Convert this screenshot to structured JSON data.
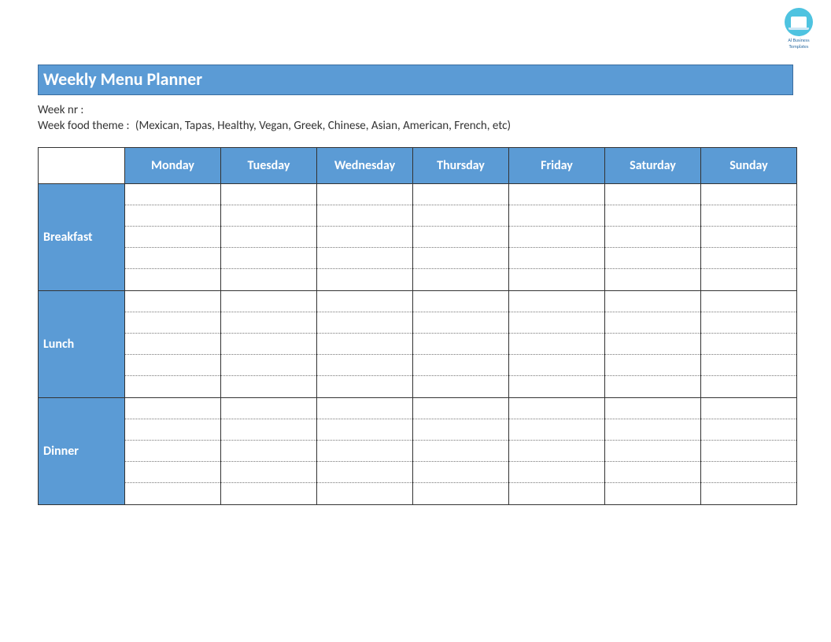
{
  "logo": {
    "line1": "Al Business",
    "line2": "Templates"
  },
  "title": "Weekly Menu Planner",
  "meta": {
    "week_nr_label": "Week nr :",
    "theme_label": "Week food theme :",
    "theme_hint": "(Mexican, Tapas, Healthy, Vegan, Greek, Chinese, Asian, American, French, etc)"
  },
  "days": [
    "Monday",
    "Tuesday",
    "Wednesday",
    "Thursday",
    "Friday",
    "Saturday",
    "Sunday"
  ],
  "meals": [
    {
      "name": "Breakfast",
      "rows": 5
    },
    {
      "name": "Lunch",
      "rows": 5
    },
    {
      "name": "Dinner",
      "rows": 5
    }
  ],
  "colors": {
    "accent": "#5b9bd5",
    "border": "#333333",
    "logo_bg": "#4ec3e0"
  }
}
